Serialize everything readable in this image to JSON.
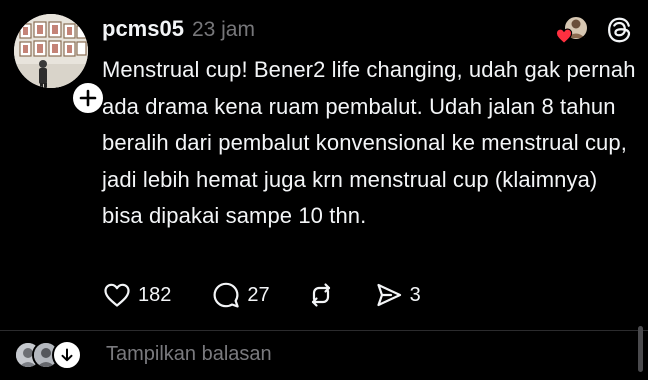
{
  "post": {
    "username": "pcms05",
    "timestamp": "23 jam",
    "text": "Menstrual cup! Bener2 life changing, udah gak pernah ada drama kena ruam pembalut. Udah jalan 8 tahun beralih dari pembalut konvensional ke menstrual cup, jadi lebih hemat juga krn menstrual cup (klaimnya) bisa dipakai sampe 10 thn.",
    "avatar_icon": "profile-photo-gallery-wall",
    "follow_icon": "plus-icon",
    "reaction_icon": "heart-icon",
    "app_icon": "threads-logo-icon",
    "actions": {
      "like_icon": "heart-outline-icon",
      "like_count": "182",
      "reply_icon": "comment-bubble-icon",
      "reply_count": "27",
      "repost_icon": "repost-arrows-icon",
      "share_icon": "send-icon",
      "share_count": "3"
    }
  },
  "replies": {
    "label": "Tampilkan balasan",
    "expand_icon": "arrow-down-icon"
  },
  "colors": {
    "background": "#000000",
    "text_primary": "#f3f5f7",
    "text_secondary": "#77777a",
    "heart_red": "#ff3040",
    "divider": "#2b2b2d"
  }
}
